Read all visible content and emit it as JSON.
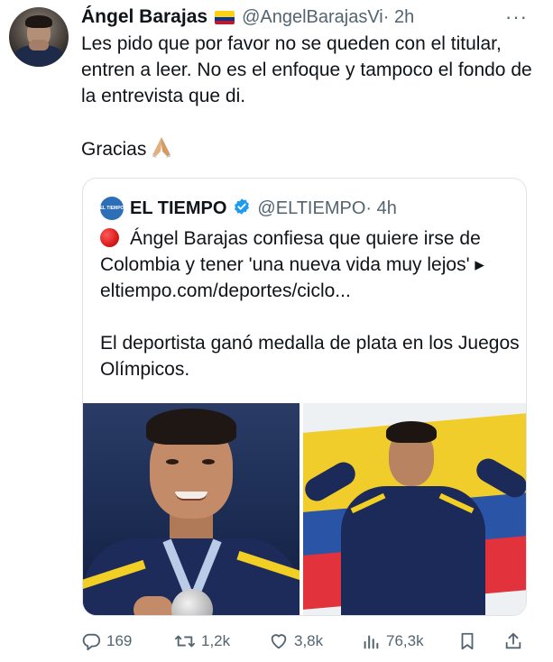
{
  "tweet": {
    "author_name": "Ángel Barajas",
    "author_handle": "@AngelBarajasVi",
    "time": "· 2h",
    "more": "···",
    "text_line1": "Les pido que por favor no se queden con el titular, entren a leer. No es el enfoque y tampoco el fondo de la entrevista que di.",
    "text_line2": "Gracias"
  },
  "quote": {
    "logo_text": "EL TIEMPO",
    "author_name": "EL TIEMPO",
    "author_handle": "@ELTIEMPO",
    "time": "· 4h",
    "text_para1": "Ángel Barajas confiesa que quiere irse de Colombia y tener 'una nueva vida muy lejos' ▸ eltiempo.com/deportes/ciclo...",
    "text_para2": "El deportista ganó medalla de plata en los Juegos Olímpicos."
  },
  "actions": {
    "replies": "169",
    "reposts": "1,2k",
    "likes": "3,8k",
    "views": "76,3k"
  },
  "icons": {
    "flag": "colombia-flag-emoji",
    "pray": "folded-hands-emoji",
    "verified": "verified-badge-icon",
    "reply": "reply-icon",
    "repost": "repost-icon",
    "like": "heart-icon",
    "views": "views-icon",
    "bookmark": "bookmark-icon",
    "share": "share-icon"
  },
  "colors": {
    "text": "#0f1419",
    "muted": "#536471",
    "verified": "#1d9bf0",
    "border": "#dfe3e7"
  }
}
